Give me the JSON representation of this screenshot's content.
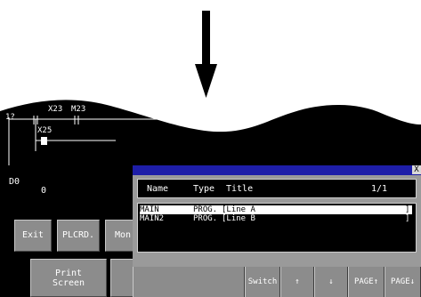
{
  "ladder": {
    "device_top_left": "1?",
    "device_top_mid": "X23",
    "device_m": "M23",
    "device_x25": "X25",
    "register": "D0",
    "register_value": "0"
  },
  "buttons": {
    "exit": "Exit",
    "plcrd": "PLCRD.",
    "mon": "Mon",
    "print_screen_line1": "Print",
    "print_screen_line2": "Screen"
  },
  "dialog": {
    "close": "X",
    "headers": {
      "name": "Name",
      "type": "Type",
      "title": "Title"
    },
    "page": "1/1",
    "programs": [
      {
        "name": "MAIN",
        "type": "PROG.",
        "title": "[Line A",
        "end": "]",
        "selected": true
      },
      {
        "name": "MAIN2",
        "type": "PROG.",
        "title": "[Line B",
        "end": "]",
        "selected": false
      }
    ],
    "footer": {
      "switch": "Switch",
      "up": "↑",
      "down": "↓",
      "page_up": "PAGE↑",
      "page_down": "PAGE↓"
    }
  },
  "colors": {
    "screen": "#000000",
    "title_bar": "#1e1ea8",
    "button": "#8c8c8c"
  }
}
